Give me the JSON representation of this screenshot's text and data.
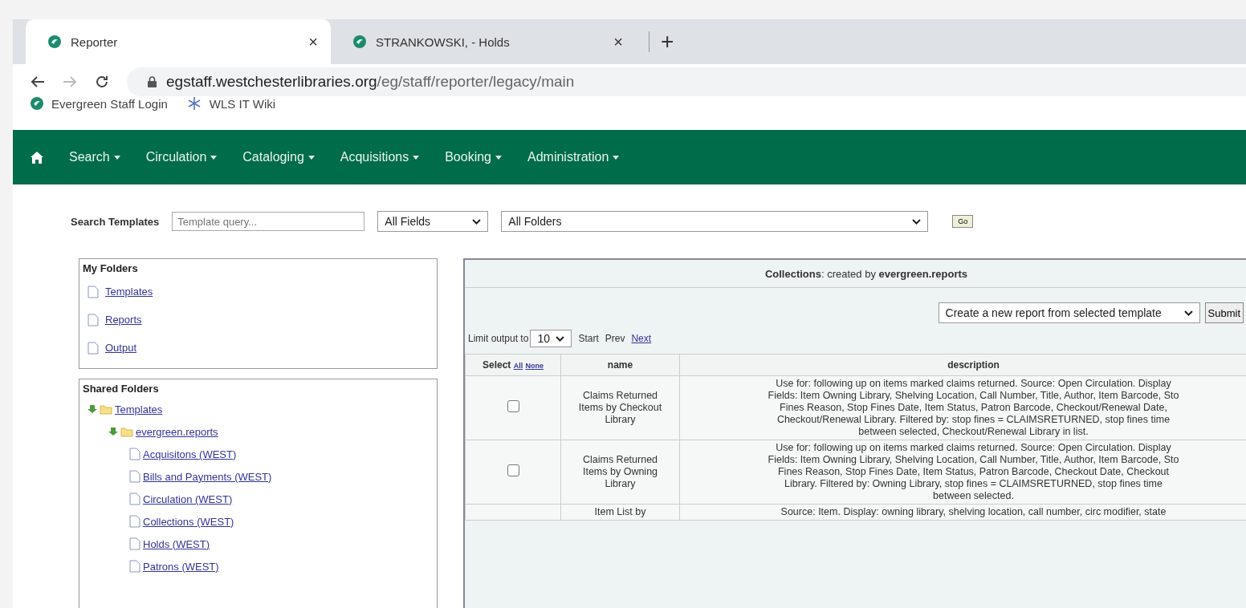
{
  "browser": {
    "tabs": [
      {
        "title": "Reporter",
        "close": "×",
        "selected": true
      },
      {
        "title": "STRANKOWSKI, - Holds",
        "close": "×",
        "selected": false
      }
    ],
    "new_tab": "+",
    "url": {
      "host": "egstaff.westchesterlibraries.org",
      "path": "/eg/staff/reporter/legacy/main"
    },
    "bookmarks": [
      {
        "label": "Evergreen Staff Login",
        "kind": "evergreen"
      },
      {
        "label": "WLS IT Wiki",
        "kind": "wiki"
      }
    ]
  },
  "nav": {
    "items": [
      "Search",
      "Circulation",
      "Cataloging",
      "Acquisitions",
      "Booking",
      "Administration"
    ]
  },
  "search": {
    "label": "Search Templates",
    "placeholder": "Template query...",
    "field_select": "All Fields",
    "folder_select": "All Folders",
    "go": "Go"
  },
  "my_folders": {
    "title": "My Folders",
    "items": [
      "Templates",
      "Reports",
      "Output"
    ]
  },
  "shared_folders": {
    "title": "Shared Folders",
    "tree": [
      {
        "label": "Templates",
        "expanded": true,
        "children": [
          {
            "label": "evergreen.reports",
            "expanded": true,
            "children": [
              {
                "label": "Acquisitons (WEST)"
              },
              {
                "label": "Bills and Payments (WEST)"
              },
              {
                "label": "Circulation (WEST)"
              },
              {
                "label": "Collections (WEST)"
              },
              {
                "label": "Holds (WEST)"
              },
              {
                "label": "Patrons (WEST)"
              }
            ]
          }
        ]
      }
    ]
  },
  "collection": {
    "title": "**Collections**: created by **evergreen.reports**",
    "action": "Create a new report from selected template",
    "submit": "Submit",
    "limit_label": "Limit output to",
    "limit": "10",
    "pager": [
      {
        "label": "Start",
        "kind": "text"
      },
      {
        "label": "Prev",
        "kind": "text"
      },
      {
        "label": "Next",
        "kind": "link"
      }
    ],
    "columns": {
      "select": "Select",
      "all": "All",
      "none": "None",
      "name": "name",
      "description": "description"
    },
    "rows": [
      {
        "checked": false,
        "name": [
          "Claims Returned",
          "Items by Checkout",
          "Library"
        ],
        "description": [
          "Use for: following up on items marked claims returned. Source: Open Circulation. Display",
          "Fields: Item Owning Library, Shelving Location, Call Number, Title, Author, Item Barcode, Sto",
          "Fines Reason, Stop Fines Date, Item Status, Patron Barcode, Checkout/Renewal Date,",
          "Checkout/Renewal Library. Filtered by: stop fines = CLAIMSRETURNED, stop fines time",
          "between selected, Checkout/Renewal Library in list."
        ]
      },
      {
        "checked": false,
        "name": [
          "Claims Returned",
          "Items by Owning",
          "Library"
        ],
        "description": [
          "Use for: following up on items marked claims returned. Source: Open Circulation. Display",
          "Fields: Item Owning Library, Shelving Location, Call Number, Title, Author, Item Barcode, Sto",
          "Fines Reason, Stop Fines Date, Item Status, Patron Barcode, Checkout Date, Checkout",
          "Library. Filtered by: Owning Library, stop fines = CLAIMSRETURNED, stop fines time",
          "between selected."
        ]
      },
      {
        "name": [
          "Item List by"
        ],
        "description": [
          "Source: Item. Display: owning library, shelving location, call number, circ modifier, state"
        ]
      }
    ]
  }
}
